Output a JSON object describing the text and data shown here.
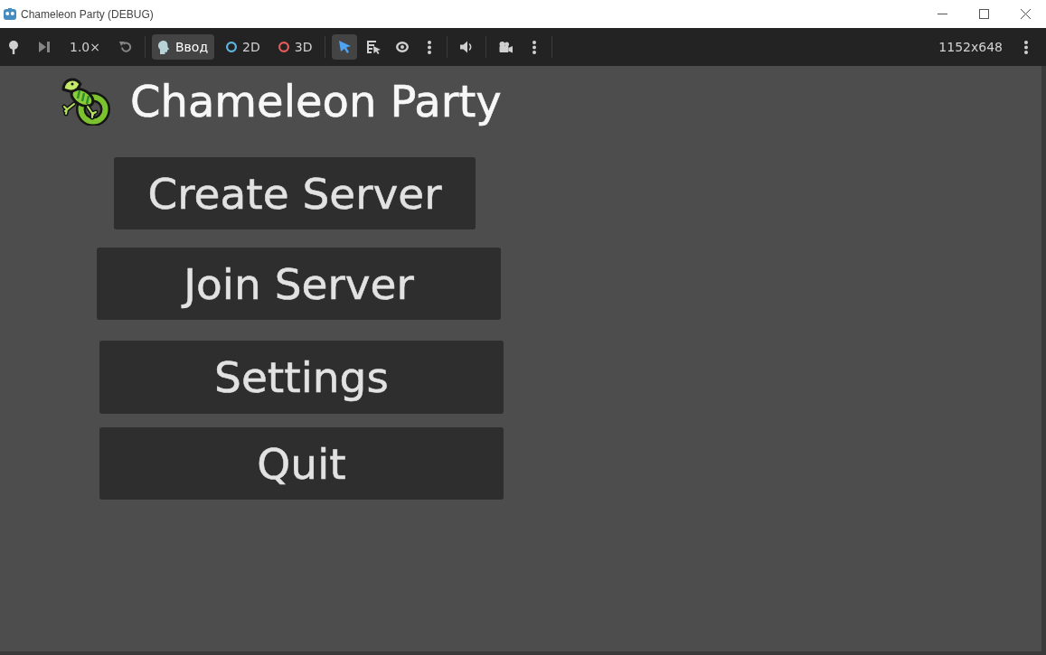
{
  "window": {
    "title": "Chameleon Party (DEBUG)"
  },
  "toolbar": {
    "groups": [
      [
        {
          "kind": "pin",
          "disabled": false
        },
        {
          "kind": "step",
          "disabled": true
        },
        {
          "kind": "speed",
          "label": "1.0×"
        },
        {
          "kind": "reset",
          "disabled": true
        }
      ],
      [
        {
          "kind": "input",
          "label": "Ввод",
          "selected": true
        },
        {
          "kind": "ring",
          "label": "2D",
          "color": "#5cb8e0",
          "selected": false
        },
        {
          "kind": "ring",
          "label": "3D",
          "color": "#e65c5c",
          "selected": false
        }
      ],
      [
        {
          "kind": "select",
          "selected": true
        },
        {
          "kind": "list",
          "selected": false
        },
        {
          "kind": "eye"
        },
        {
          "kind": "more"
        }
      ],
      [
        {
          "kind": "speaker"
        }
      ],
      [
        {
          "kind": "camera"
        },
        {
          "kind": "more"
        }
      ]
    ],
    "resolution": "1152x648"
  },
  "game": {
    "title": "Chameleon Party",
    "buttons": [
      "Create Server",
      "Join Server",
      "Settings",
      "Quit"
    ]
  }
}
